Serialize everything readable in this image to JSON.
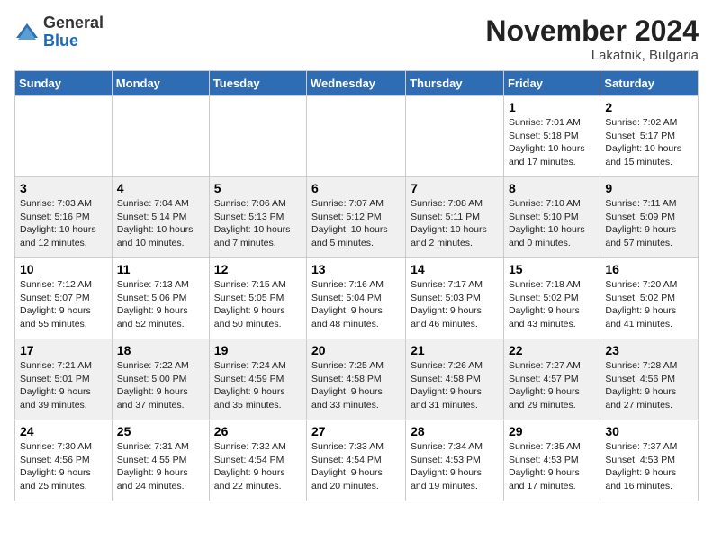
{
  "header": {
    "logo_general": "General",
    "logo_blue": "Blue",
    "title": "November 2024",
    "subtitle": "Lakatnik, Bulgaria"
  },
  "columns": [
    "Sunday",
    "Monday",
    "Tuesday",
    "Wednesday",
    "Thursday",
    "Friday",
    "Saturday"
  ],
  "weeks": [
    [
      {
        "day": "",
        "info": ""
      },
      {
        "day": "",
        "info": ""
      },
      {
        "day": "",
        "info": ""
      },
      {
        "day": "",
        "info": ""
      },
      {
        "day": "",
        "info": ""
      },
      {
        "day": "1",
        "info": "Sunrise: 7:01 AM\nSunset: 5:18 PM\nDaylight: 10 hours and 17 minutes."
      },
      {
        "day": "2",
        "info": "Sunrise: 7:02 AM\nSunset: 5:17 PM\nDaylight: 10 hours and 15 minutes."
      }
    ],
    [
      {
        "day": "3",
        "info": "Sunrise: 7:03 AM\nSunset: 5:16 PM\nDaylight: 10 hours and 12 minutes."
      },
      {
        "day": "4",
        "info": "Sunrise: 7:04 AM\nSunset: 5:14 PM\nDaylight: 10 hours and 10 minutes."
      },
      {
        "day": "5",
        "info": "Sunrise: 7:06 AM\nSunset: 5:13 PM\nDaylight: 10 hours and 7 minutes."
      },
      {
        "day": "6",
        "info": "Sunrise: 7:07 AM\nSunset: 5:12 PM\nDaylight: 10 hours and 5 minutes."
      },
      {
        "day": "7",
        "info": "Sunrise: 7:08 AM\nSunset: 5:11 PM\nDaylight: 10 hours and 2 minutes."
      },
      {
        "day": "8",
        "info": "Sunrise: 7:10 AM\nSunset: 5:10 PM\nDaylight: 10 hours and 0 minutes."
      },
      {
        "day": "9",
        "info": "Sunrise: 7:11 AM\nSunset: 5:09 PM\nDaylight: 9 hours and 57 minutes."
      }
    ],
    [
      {
        "day": "10",
        "info": "Sunrise: 7:12 AM\nSunset: 5:07 PM\nDaylight: 9 hours and 55 minutes."
      },
      {
        "day": "11",
        "info": "Sunrise: 7:13 AM\nSunset: 5:06 PM\nDaylight: 9 hours and 52 minutes."
      },
      {
        "day": "12",
        "info": "Sunrise: 7:15 AM\nSunset: 5:05 PM\nDaylight: 9 hours and 50 minutes."
      },
      {
        "day": "13",
        "info": "Sunrise: 7:16 AM\nSunset: 5:04 PM\nDaylight: 9 hours and 48 minutes."
      },
      {
        "day": "14",
        "info": "Sunrise: 7:17 AM\nSunset: 5:03 PM\nDaylight: 9 hours and 46 minutes."
      },
      {
        "day": "15",
        "info": "Sunrise: 7:18 AM\nSunset: 5:02 PM\nDaylight: 9 hours and 43 minutes."
      },
      {
        "day": "16",
        "info": "Sunrise: 7:20 AM\nSunset: 5:02 PM\nDaylight: 9 hours and 41 minutes."
      }
    ],
    [
      {
        "day": "17",
        "info": "Sunrise: 7:21 AM\nSunset: 5:01 PM\nDaylight: 9 hours and 39 minutes."
      },
      {
        "day": "18",
        "info": "Sunrise: 7:22 AM\nSunset: 5:00 PM\nDaylight: 9 hours and 37 minutes."
      },
      {
        "day": "19",
        "info": "Sunrise: 7:24 AM\nSunset: 4:59 PM\nDaylight: 9 hours and 35 minutes."
      },
      {
        "day": "20",
        "info": "Sunrise: 7:25 AM\nSunset: 4:58 PM\nDaylight: 9 hours and 33 minutes."
      },
      {
        "day": "21",
        "info": "Sunrise: 7:26 AM\nSunset: 4:58 PM\nDaylight: 9 hours and 31 minutes."
      },
      {
        "day": "22",
        "info": "Sunrise: 7:27 AM\nSunset: 4:57 PM\nDaylight: 9 hours and 29 minutes."
      },
      {
        "day": "23",
        "info": "Sunrise: 7:28 AM\nSunset: 4:56 PM\nDaylight: 9 hours and 27 minutes."
      }
    ],
    [
      {
        "day": "24",
        "info": "Sunrise: 7:30 AM\nSunset: 4:56 PM\nDaylight: 9 hours and 25 minutes."
      },
      {
        "day": "25",
        "info": "Sunrise: 7:31 AM\nSunset: 4:55 PM\nDaylight: 9 hours and 24 minutes."
      },
      {
        "day": "26",
        "info": "Sunrise: 7:32 AM\nSunset: 4:54 PM\nDaylight: 9 hours and 22 minutes."
      },
      {
        "day": "27",
        "info": "Sunrise: 7:33 AM\nSunset: 4:54 PM\nDaylight: 9 hours and 20 minutes."
      },
      {
        "day": "28",
        "info": "Sunrise: 7:34 AM\nSunset: 4:53 PM\nDaylight: 9 hours and 19 minutes."
      },
      {
        "day": "29",
        "info": "Sunrise: 7:35 AM\nSunset: 4:53 PM\nDaylight: 9 hours and 17 minutes."
      },
      {
        "day": "30",
        "info": "Sunrise: 7:37 AM\nSunset: 4:53 PM\nDaylight: 9 hours and 16 minutes."
      }
    ]
  ]
}
